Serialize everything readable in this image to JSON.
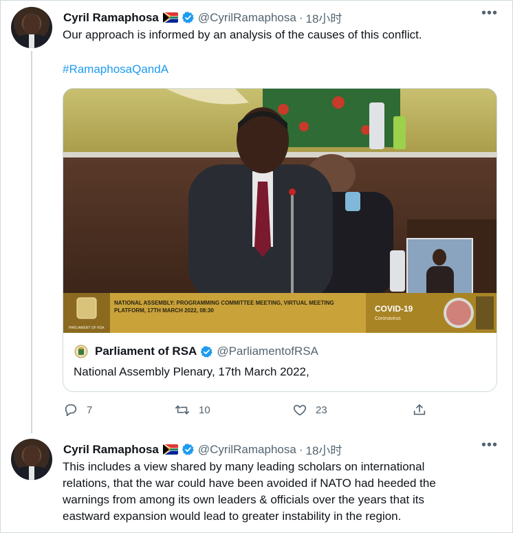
{
  "tweets": [
    {
      "author_name": "Cyril Ramaphosa",
      "flag": "🇿🇦",
      "handle": "@CyrilRamaphosa",
      "separator": "·",
      "time": "18小时",
      "text": "Our approach is informed by an analysis of the causes of this conflict.",
      "hashtag": "#RamaphosaQandA",
      "quoted": {
        "author_name": "Parliament of RSA",
        "handle": "@ParliamentofRSA",
        "text": "National Assembly Plenary, 17th March 2022,",
        "video_banner_title": "NATIONAL ASSEMBLY: PROGRAMMING COMMITTEE MEETING, VIRTUAL MEETING",
        "video_banner_subtitle": "PLATFORM, 17TH MARCH 2022, 08:30",
        "video_covid_label": "COVID-19",
        "video_covid_sublabel": "Coronavirus",
        "video_logo_caption": "PARLIAMENT OF RSA"
      },
      "actions": {
        "reply_count": "7",
        "retweet_count": "10",
        "like_count": "23"
      }
    },
    {
      "author_name": "Cyril Ramaphosa",
      "flag": "🇿🇦",
      "handle": "@CyrilRamaphosa",
      "separator": "·",
      "time": "18小时",
      "text_lines": [
        "This includes a view shared by many leading scholars on international",
        "relations, that the war could have been avoided if NATO had heeded the",
        "warnings from among its own leaders & officials over the years that its",
        "eastward expansion would lead to greater instability in the region."
      ]
    }
  ],
  "icons": {
    "more": "more-icon",
    "verified": "verified-badge-icon",
    "reply": "reply-icon",
    "retweet": "retweet-icon",
    "like": "heart-icon",
    "share": "share-icon"
  },
  "colors": {
    "accent": "#1d9bf0",
    "secondary_text": "#536471",
    "border": "#cfd9de",
    "banner_gold": "#c9a23a"
  }
}
